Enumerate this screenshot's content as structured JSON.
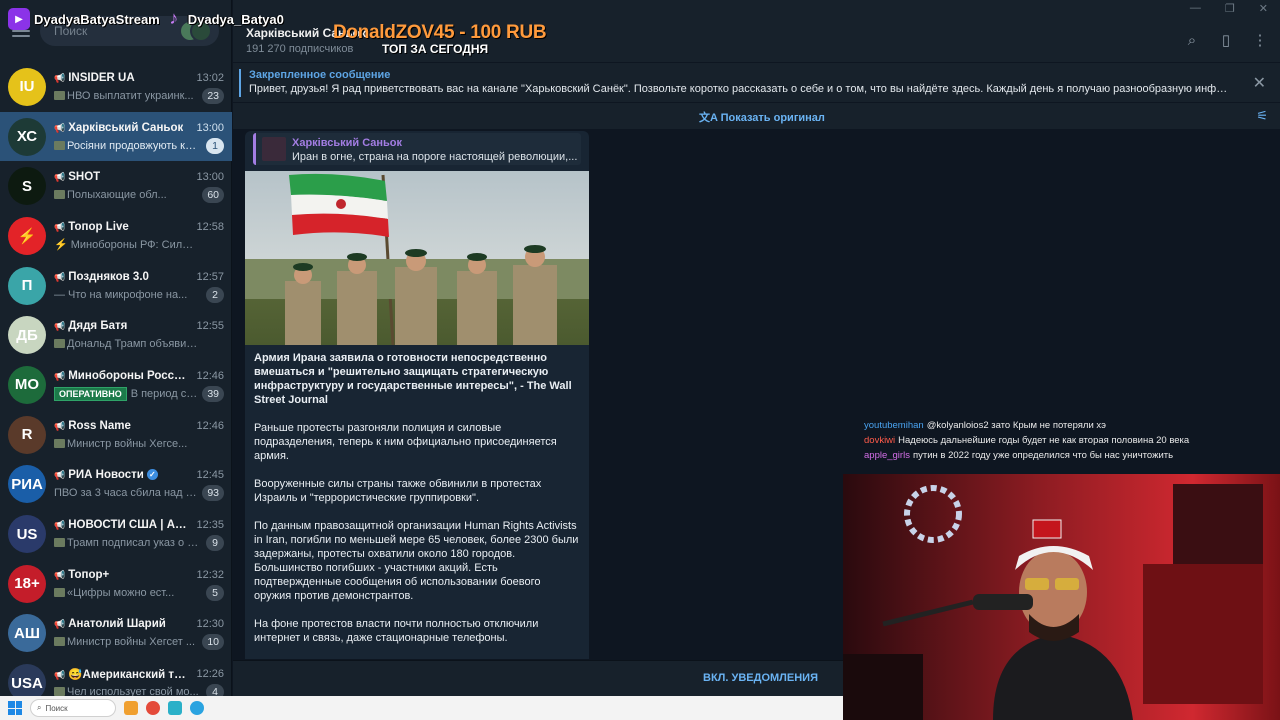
{
  "stream": {
    "channel1": "DyadyaBatyaStream",
    "channel2": "Dyadya_Batya0",
    "donation": "DonaldZOV45 - 100 RUB",
    "top_today": "ТОП ЗА СЕГОДНЯ"
  },
  "search": {
    "placeholder": "Поиск"
  },
  "chats": [
    {
      "name": "INSIDER UA",
      "time": "13:02",
      "snippet": "НВО выплатит украинк...",
      "badge": "23",
      "avatar_color": "#e5c21a",
      "avatar_text": "IU",
      "mini": true
    },
    {
      "name": "Харківський Саньок",
      "time": "13:00",
      "snippet": "Росіяни продовжують ко...",
      "badge": "1",
      "avatar_color": "#1d3a36",
      "avatar_text": "ХС",
      "mini": true,
      "active": true
    },
    {
      "name": "SHOT",
      "time": "13:00",
      "snippet": "Полыхающие обл...",
      "badge": "60",
      "avatar_color": "#0d1a10",
      "avatar_text": "S",
      "mini": true
    },
    {
      "name": "Топор Live",
      "time": "12:58",
      "snippet": "⚡ Минобороны РФ: Силы ПВО ...",
      "badge": "",
      "avatar_color": "#e32328",
      "avatar_text": "⚡"
    },
    {
      "name": "Поздняков 3.0",
      "time": "12:57",
      "snippet": "— Что на микрофоне на...",
      "badge": "2",
      "avatar_color": "#3aa5a8",
      "avatar_text": "П"
    },
    {
      "name": "Дядя Батя",
      "time": "12:55",
      "snippet": "Дональд Трамп объявил о в...",
      "badge": "",
      "avatar_color": "#c8d6c0",
      "avatar_text": "ДБ",
      "mini": true
    },
    {
      "name": "Минобороны России",
      "time": "12:46",
      "snippet": "В период с 20...",
      "badge": "39",
      "avatar_color": "#1d6b3b",
      "avatar_text": "МО",
      "verified": true,
      "oper": "ОПЕРАТИВНО"
    },
    {
      "name": "Ross Name",
      "time": "12:46",
      "snippet": "Министр войны Хегсе...",
      "badge": "",
      "avatar_color": "#5a3a2a",
      "avatar_text": "R",
      "mini": true
    },
    {
      "name": "РИА Новости",
      "time": "12:45",
      "snippet": "ПВО за 3 часа сбила над ро...",
      "badge": "93",
      "avatar_color": "#1a5ea8",
      "avatar_text": "РИА",
      "verified": true
    },
    {
      "name": "НОВОСТИ США | АМЕ...",
      "time": "12:35",
      "snippet": "Трамп подписал указ о з...",
      "badge": "9",
      "avatar_color": "#2a3a6a",
      "avatar_text": "US",
      "mini": true
    },
    {
      "name": "Топор+",
      "time": "12:32",
      "snippet": "«Цифры можно ест...",
      "badge": "5",
      "avatar_color": "#c41d2a",
      "avatar_text": "18+",
      "mini": true
    },
    {
      "name": "Анатолий Шарий",
      "time": "12:30",
      "snippet": "Министр войны Хегсет ...",
      "badge": "10",
      "avatar_color": "#3a6a9a",
      "avatar_text": "АШ",
      "mini": true
    },
    {
      "name": "😅Американский тре...",
      "time": "12:26",
      "snippet": "Чел использует свой мо...",
      "badge": "4",
      "avatar_color": "#2a3a5a",
      "avatar_text": "USA",
      "mini": true
    }
  ],
  "header": {
    "title": "Харківський Саньок",
    "subscribers": "191 270 подписчиков"
  },
  "pinned": {
    "label": "Закрепленное сообщение",
    "text": "Привет, друзья! Я рад приветствовать вас на канале \"Харьковский Санёк\". Позвольте коротко рассказать о себе и о том, что вы найдёте здесь.  Каждый день я получаю разнообразную информ..."
  },
  "translate": {
    "show_original": "Показать оригинал"
  },
  "message": {
    "forward_from": "Харківський Саньок",
    "forward_text": "Иран в огне, страна на пороге настоящей революции,...",
    "headline": "Армия Ирана заявила о готовности непосредственно вмешаться и \"решительно защищать стратегическую инфраструктуру и государственные интересы\", - The Wall Street Journal",
    "p1": "Раньше протесты разгоняли полиция и силовые подразделения, теперь к ним официально присоединяется армия.",
    "p2": "Вооруженные силы страны также обвинили в протестах Израиль и \"террористические группировки\".",
    "p3": "По данным правозащитной организации Human Rights Activists in Iran, погибли по меньшей мере 65 человек, более 2300 были задержаны, протесты охватили около 180 городов. Большинство погибших - участники акций. Есть подтвержденные сообщения об использовании боевого оружия против демонстрантов.",
    "p4": "На фоне протестов власти почти полностью отключили интернет и связь, даже стационарные телефоны."
  },
  "bottom": {
    "notifications": "ВКЛ. УВЕДОМЛЕНИЯ"
  },
  "stream_chat": [
    {
      "user": "youtubemihan",
      "text": "@kolyanloios2 зато Крым не потеряли хэ"
    },
    {
      "user": "dovkiwi",
      "text": "Надеюсь дальнейшие годы будет не как вторая половина 20 века"
    },
    {
      "user": "apple_girls",
      "text": "путин в 2022 году уже определился что бы нас уничтожить"
    }
  ],
  "taskbar": {
    "search_placeholder": "Поиск"
  }
}
